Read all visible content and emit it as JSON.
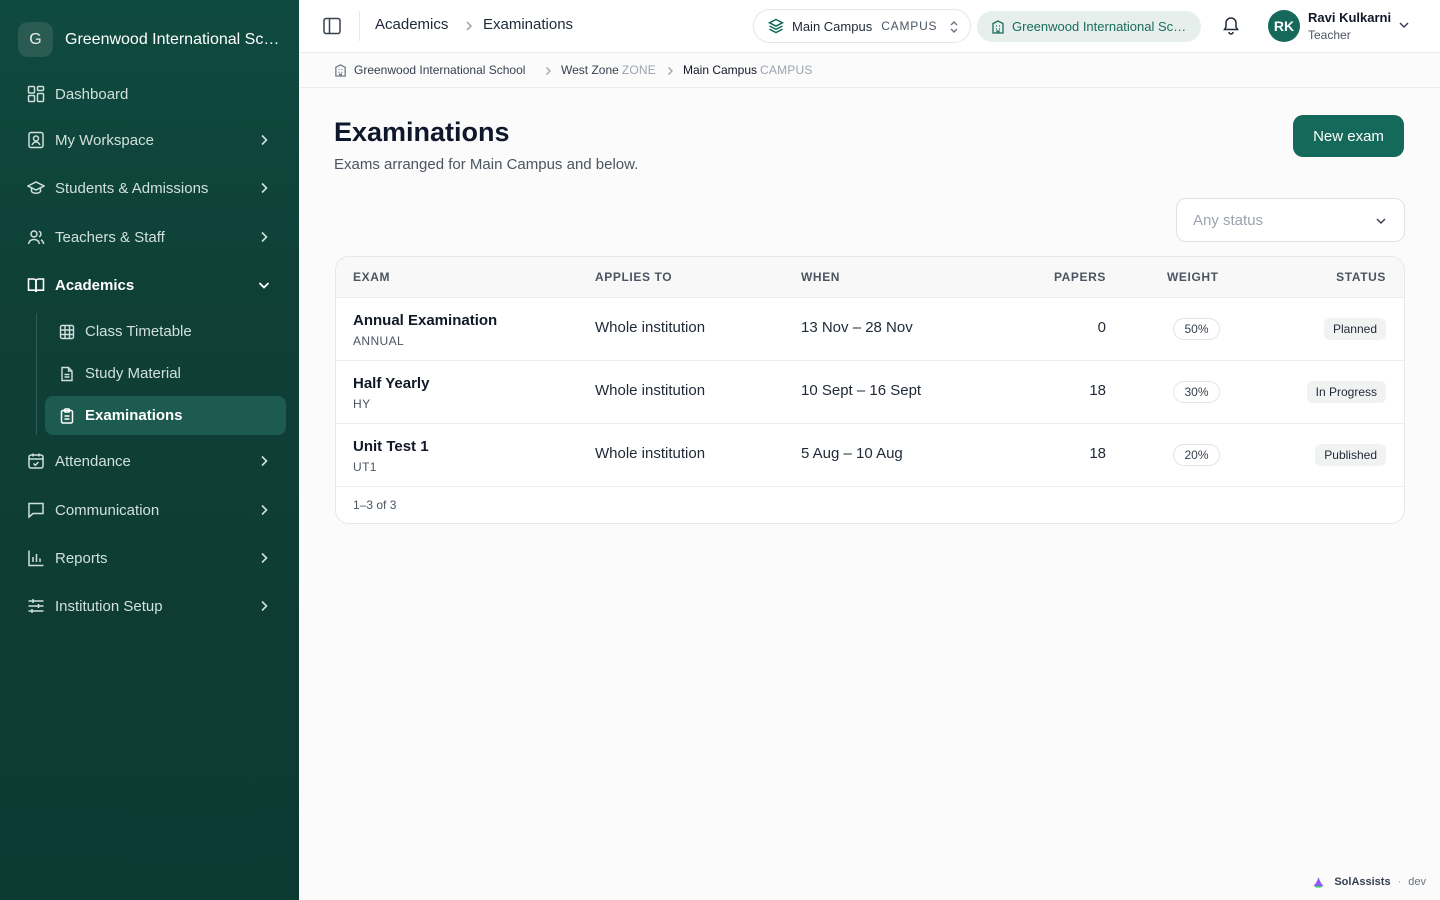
{
  "brand": {
    "initial": "G",
    "name": "Greenwood International School"
  },
  "nav": {
    "dashboard": "Dashboard",
    "workspace": "My Workspace",
    "students": "Students & Admissions",
    "teachers": "Teachers & Staff",
    "academics": "Academics",
    "academics_sub": [
      "Class Timetable",
      "Study Material",
      "Examinations"
    ],
    "attendance": "Attendance",
    "communication": "Communication",
    "reports": "Reports",
    "setup": "Institution Setup"
  },
  "topbar": {
    "crumb_section": "Academics",
    "crumb_page": "Examinations",
    "campus_name": "Main Campus",
    "campus_tag": "CAMPUS",
    "school_name": "Greenwood International School",
    "user_initials": "RK",
    "user_name": "Ravi Kulkarni",
    "user_role": "Teacher"
  },
  "breadcrumb": {
    "school": "Greenwood International School",
    "zone": "West Zone",
    "zone_level": "ZONE",
    "campus": "Main Campus",
    "campus_level": "CAMPUS"
  },
  "page": {
    "title": "Examinations",
    "subtitle": "Exams arranged for Main Campus and below.",
    "new_button": "New exam",
    "status_filter_placeholder": "Any status"
  },
  "table": {
    "headers": [
      "EXAM",
      "APPLIES TO",
      "WHEN",
      "PAPERS",
      "WEIGHT",
      "STATUS"
    ],
    "rows": [
      {
        "name": "Annual Examination",
        "code": "ANNUAL",
        "applies": "Whole institution",
        "when": "13 Nov – 28 Nov",
        "papers": "0",
        "weight": "50%",
        "status": "Planned"
      },
      {
        "name": "Half Yearly",
        "code": "HY",
        "applies": "Whole institution",
        "when": "10 Sept – 16 Sept",
        "papers": "18",
        "weight": "30%",
        "status": "In Progress"
      },
      {
        "name": "Unit Test 1",
        "code": "UT1",
        "applies": "Whole institution",
        "when": "5 Aug – 10 Aug",
        "papers": "18",
        "weight": "20%",
        "status": "Published"
      }
    ],
    "pager": "1–3 of 3"
  },
  "footer": {
    "brand": "SolAssists",
    "env": "dev"
  },
  "colors": {
    "sidebar": "#0f4a40",
    "accent": "#14695a",
    "active_item": "#1d5a4f"
  },
  "icons": [
    "dashboard-icon",
    "workspace-icon",
    "graduation-cap-icon",
    "users-icon",
    "book-icon",
    "grid-icon",
    "document-icon",
    "clipboard-icon",
    "calendar-icon",
    "message-icon",
    "bar-chart-icon",
    "sliders-icon",
    "layers-icon",
    "building-icon",
    "bell-icon",
    "sidebar-toggle-icon"
  ]
}
